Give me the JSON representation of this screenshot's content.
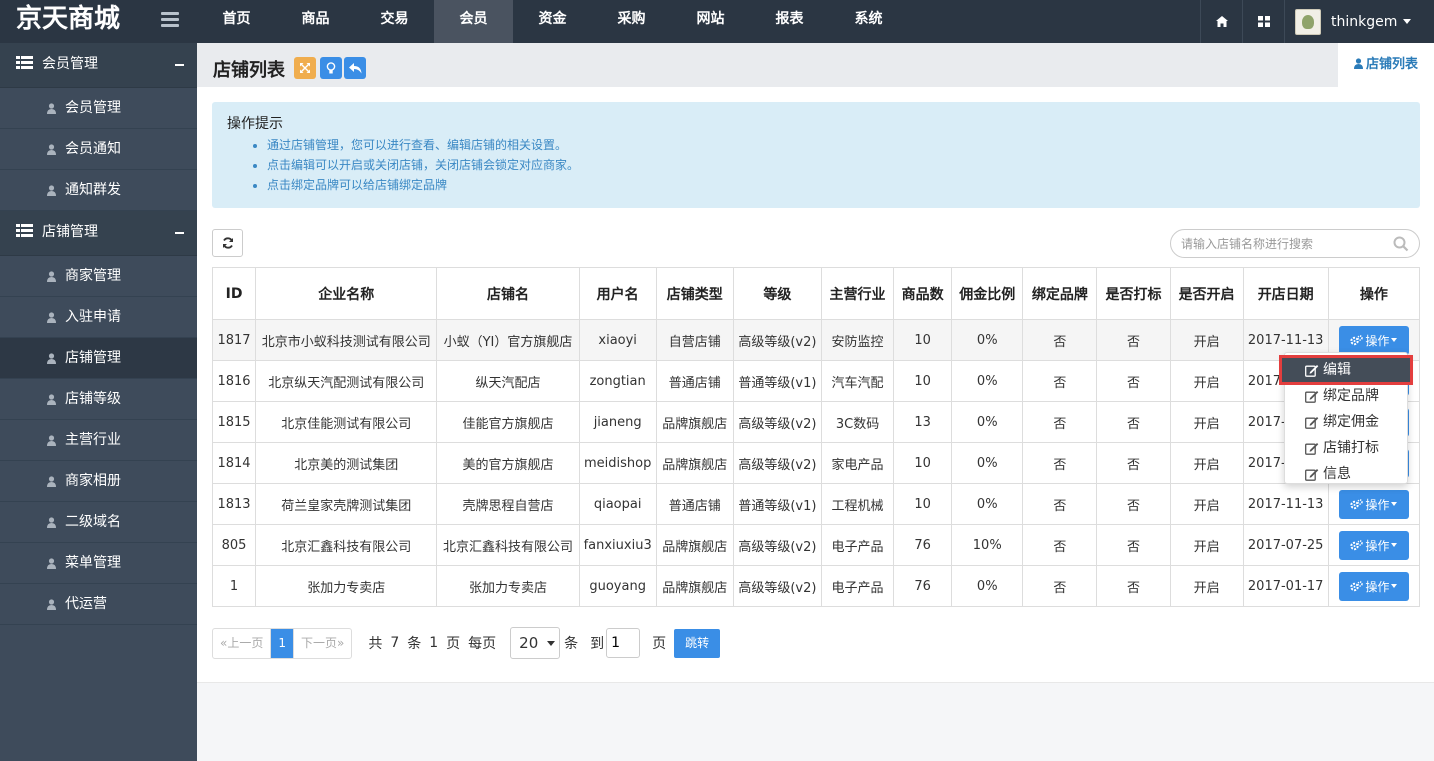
{
  "brand": "京天商城",
  "nav": [
    "首页",
    "商品",
    "交易",
    "会员",
    "资金",
    "采购",
    "网站",
    "报表",
    "系统"
  ],
  "nav_active": "会员",
  "user": {
    "name": "thinkgem"
  },
  "sidebar": {
    "groups": [
      {
        "title": "会员管理",
        "items": [
          "会员管理",
          "会员通知",
          "通知群发"
        ]
      },
      {
        "title": "店铺管理",
        "items": [
          "商家管理",
          "入驻申请",
          "店铺管理",
          "店铺等级",
          "主营行业",
          "商家相册",
          "二级域名",
          "菜单管理",
          "代运营"
        ]
      }
    ],
    "active_item": "店铺管理"
  },
  "page": {
    "title": "店铺列表",
    "breadcrumb": "店铺列表"
  },
  "tips": {
    "title": "操作提示",
    "items": [
      "通过店铺管理，您可以进行查看、编辑店铺的相关设置。",
      "点击编辑可以开启或关闭店铺，关闭店铺会锁定对应商家。",
      "点击绑定品牌可以给店铺绑定品牌"
    ]
  },
  "search": {
    "placeholder": "请输入店铺名称进行搜索",
    "value": ""
  },
  "table": {
    "columns": [
      "ID",
      "企业名称",
      "店铺名",
      "用户名",
      "店铺类型",
      "等级",
      "主营行业",
      "商品数",
      "佣金比例",
      "绑定品牌",
      "是否打标",
      "是否开启",
      "开店日期",
      "操作"
    ],
    "rows": [
      [
        "1817",
        "北京市小蚁科技测试有限公司",
        "小蚁（YI）官方旗舰店",
        "xiaoyi",
        "自营店铺",
        "高级等级(v2)",
        "安防监控",
        "10",
        "0%",
        "否",
        "否",
        "开启",
        "2017-11-13"
      ],
      [
        "1816",
        "北京纵天汽配测试有限公司",
        "纵天汽配店",
        "zongtian",
        "普通店铺",
        "普通等级(v1)",
        "汽车汽配",
        "10",
        "0%",
        "否",
        "否",
        "开启",
        "2017-11-13"
      ],
      [
        "1815",
        "北京佳能测试有限公司",
        "佳能官方旗舰店",
        "jianeng",
        "品牌旗舰店",
        "高级等级(v2)",
        "3C数码",
        "13",
        "0%",
        "否",
        "否",
        "开启",
        "2017-11-13"
      ],
      [
        "1814",
        "北京美的测试集团",
        "美的官方旗舰店",
        "meidishop",
        "品牌旗舰店",
        "高级等级(v2)",
        "家电产品",
        "10",
        "0%",
        "否",
        "否",
        "开启",
        "2017-11-13"
      ],
      [
        "1813",
        "荷兰皇家壳牌测试集团",
        "壳牌思程自营店",
        "qiaopai",
        "普通店铺",
        "普通等级(v1)",
        "工程机械",
        "10",
        "0%",
        "否",
        "否",
        "开启",
        "2017-11-13"
      ],
      [
        "805",
        "北京汇鑫科技有限公司",
        "北京汇鑫科技有限公司",
        "fanxiuxiu3",
        "品牌旗舰店",
        "高级等级(v2)",
        "电子产品",
        "76",
        "10%",
        "否",
        "否",
        "开启",
        "2017-07-25"
      ],
      [
        "1",
        "张加力专卖店",
        "张加力专卖店",
        "guoyang",
        "品牌旗舰店",
        "高级等级(v2)",
        "电子产品",
        "76",
        "0%",
        "否",
        "否",
        "开启",
        "2017-01-17"
      ]
    ],
    "op_label": "操作"
  },
  "dropdown": {
    "items": [
      "编辑",
      "绑定品牌",
      "绑定佣金",
      "店铺打标",
      "信息"
    ],
    "selected": "编辑"
  },
  "pager": {
    "prev": "«上一页",
    "current": "1",
    "next": "下一页»",
    "total_prefix": "共",
    "total": "7",
    "total_unit": "条",
    "pages": "1",
    "pages_unit": "页",
    "per_page_label": "每页",
    "per_page": "20",
    "per_page_unit": "条",
    "goto_label": "到",
    "goto_value": "1",
    "goto_unit": "页",
    "go_button": "跳转"
  },
  "colors": {
    "topbar": "#2b3643",
    "sidebar": "#3e4b5b",
    "accent": "#3a8ee6",
    "tips_bg": "#d9edf7",
    "highlight": "#e33e3e"
  }
}
